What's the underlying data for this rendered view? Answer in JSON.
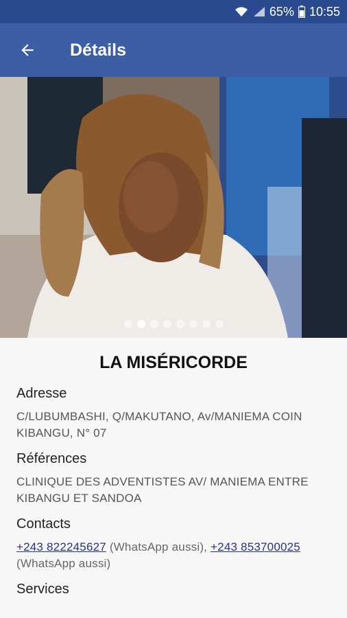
{
  "status_bar": {
    "battery": "65%",
    "time": "10:55"
  },
  "app_bar": {
    "title": "Détails"
  },
  "carousel": {
    "slide_count": 8,
    "active_index": 1
  },
  "place": {
    "name": "LA MISÉRICORDE",
    "address_label": "Adresse",
    "address": "C/LUBUMBASHI, Q/MAKUTANO, Av/MANIEMA COIN KIBANGU, N° 07",
    "references_label": "Références",
    "references": "CLINIQUE DES ADVENTISTES AV/ MANIEMA ENTRE KIBANGU ET SANDOA",
    "contacts_label": "Contacts",
    "contacts": [
      {
        "phone": "+243 822245627",
        "note": " (WhatsApp aussi), "
      },
      {
        "phone": "+243 853700025",
        "note": " (WhatsApp aussi)"
      }
    ],
    "services_label": "Services"
  },
  "icons": {
    "wifi": "wifi-icon",
    "signal": "signal-icon",
    "battery": "battery-icon",
    "back": "arrow-back-icon"
  },
  "colors": {
    "status_bar": "#2a4a8f",
    "app_bar": "#3b5ea5",
    "link": "#27308a"
  }
}
